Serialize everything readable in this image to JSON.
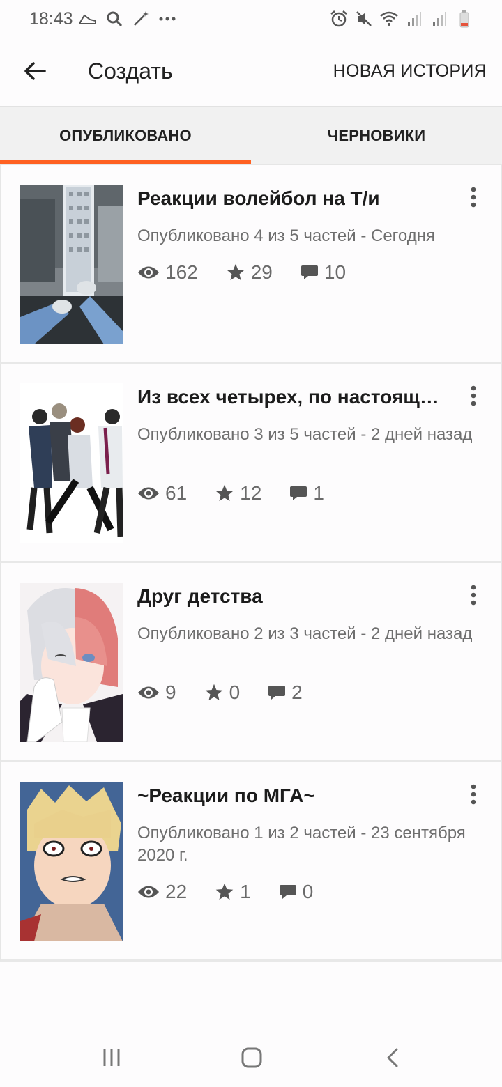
{
  "status_bar": {
    "time": "18:43",
    "left_icons": [
      "sneaker-icon",
      "search-icon",
      "magic-wand-icon",
      "more-dots-icon"
    ],
    "right_icons": [
      "alarm-icon",
      "mute-icon",
      "wifi-icon",
      "signal-icon",
      "signal-icon",
      "battery-icon"
    ]
  },
  "app_bar": {
    "title": "Создать",
    "action": "НОВАЯ ИСТОРИЯ"
  },
  "tabs": {
    "published": "ОПУБЛИКОВАНО",
    "drafts": "ЧЕРНОВИКИ",
    "active": "published"
  },
  "stories": [
    {
      "title": "Реакции волейбол на Т/и",
      "meta": "Опубликовано 4 из 5 частей - Сегодня",
      "views": "162",
      "votes": "29",
      "comments": "10"
    },
    {
      "title": "Из всех четырех, по настоящему",
      "meta": "Опубликовано 3 из 5 частей - 2 дней назад",
      "views": "61",
      "votes": "12",
      "comments": "1"
    },
    {
      "title": "Друг детства",
      "meta": "Опубликовано 2 из 3 частей - 2 дней назад",
      "views": "9",
      "votes": "0",
      "comments": "2"
    },
    {
      "title": "~Реакции по МГА~",
      "meta": "Опубликовано 1 из 2 частей - 23 сентября 2020 г.",
      "views": "22",
      "votes": "1",
      "comments": "0"
    }
  ],
  "colors": {
    "accent": "#ff6122",
    "text": "#222222",
    "muted": "#6e6e6e"
  }
}
